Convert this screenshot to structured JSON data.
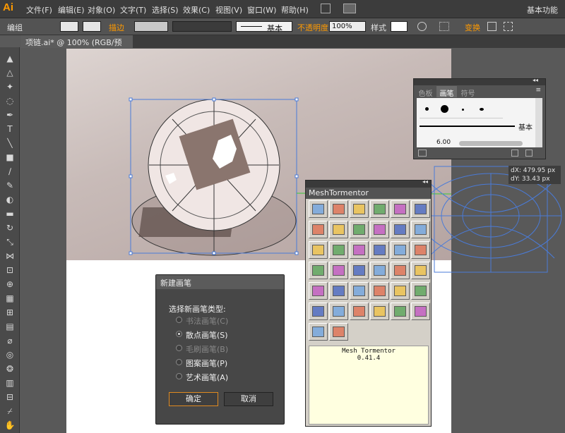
{
  "app": {
    "logo": "Ai",
    "workspace": "基本功能"
  },
  "menu": [
    "文件(F)",
    "编辑(E)",
    "对象(O)",
    "文字(T)",
    "选择(S)",
    "效果(C)",
    "视图(V)",
    "窗口(W)",
    "帮助(H)"
  ],
  "control": {
    "group_label": "编组",
    "stroke_label": "描边",
    "stroke_style": "基本",
    "opacity_label": "不透明度",
    "opacity_value": "100%",
    "style_label": "样式",
    "transform_label": "变换"
  },
  "doc_tab": "项链.ai* @ 100% (RGB/预览)",
  "brush_panel": {
    "tabs": [
      "色板",
      "画笔",
      "符号"
    ],
    "basic": "基本",
    "size": "6.00"
  },
  "measure": {
    "dx": "dX: 479.95 px",
    "dy": "dY: 33.43 px"
  },
  "mesh": {
    "title": "MeshTormentor",
    "info_name": "Mesh Tormentor",
    "version": "0.41.4"
  },
  "dialog": {
    "title": "新建画笔",
    "prompt": "选择新画笔类型:",
    "options": [
      "书法画笔(C)",
      "散点画笔(S)",
      "毛刷画笔(B)",
      "图案画笔(P)",
      "艺术画笔(A)"
    ],
    "ok": "确定",
    "cancel": "取消"
  },
  "colors": {
    "accent": "#ff9a00",
    "selection": "#4a7bd8",
    "guide": "#38c838"
  }
}
